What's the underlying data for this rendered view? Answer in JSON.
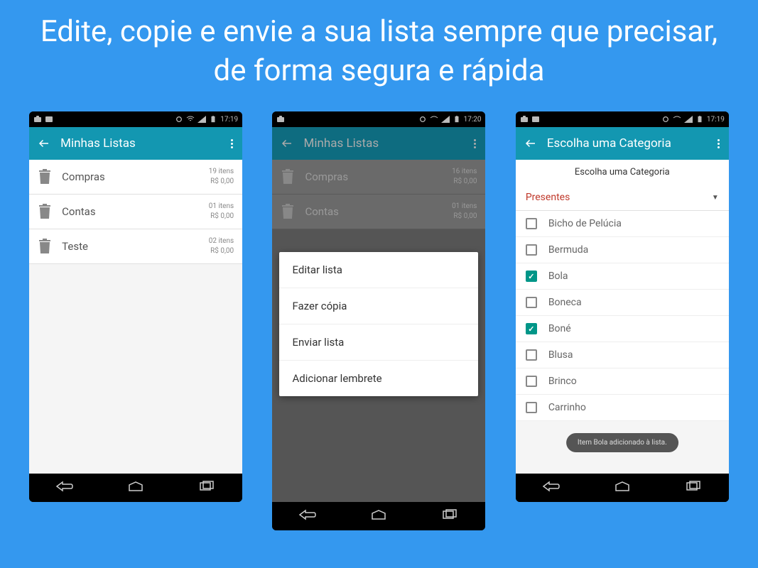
{
  "headline": "Edite, copie e envie a sua lista sempre que precisar, de forma segura e rápida",
  "status": {
    "time1": "17:19",
    "time2": "17:20",
    "time3": "17:19"
  },
  "phone1": {
    "title": "Minhas Listas",
    "rows": [
      {
        "label": "Compras",
        "items": "19 itens",
        "price": "R$ 0,00"
      },
      {
        "label": "Contas",
        "items": "01 itens",
        "price": "R$ 0,00"
      },
      {
        "label": "Teste",
        "items": "02 itens",
        "price": "R$ 0,00"
      }
    ]
  },
  "phone2": {
    "title": "Minhas Listas",
    "rows": [
      {
        "label": "Compras",
        "items": "16 itens",
        "price": "R$ 0,00"
      },
      {
        "label": "Contas",
        "items": "01 itens",
        "price": "R$ 0,00"
      }
    ],
    "menu": [
      "Editar lista",
      "Fazer cópia",
      "Enviar lista",
      "Adicionar lembrete"
    ]
  },
  "phone3": {
    "title": "Escolha uma Categoria",
    "subheader": "Escolha uma Categoria",
    "dropdown": "Presentes",
    "items": [
      {
        "label": "Bicho de Pelúcia",
        "checked": false
      },
      {
        "label": "Bermuda",
        "checked": false
      },
      {
        "label": "Bola",
        "checked": true
      },
      {
        "label": "Boneca",
        "checked": false
      },
      {
        "label": "Boné",
        "checked": true
      },
      {
        "label": "Blusa",
        "checked": false
      },
      {
        "label": "Brinco",
        "checked": false
      },
      {
        "label": "Carrinho",
        "checked": false
      }
    ],
    "toast": "Item Bola adicionado à lista."
  }
}
